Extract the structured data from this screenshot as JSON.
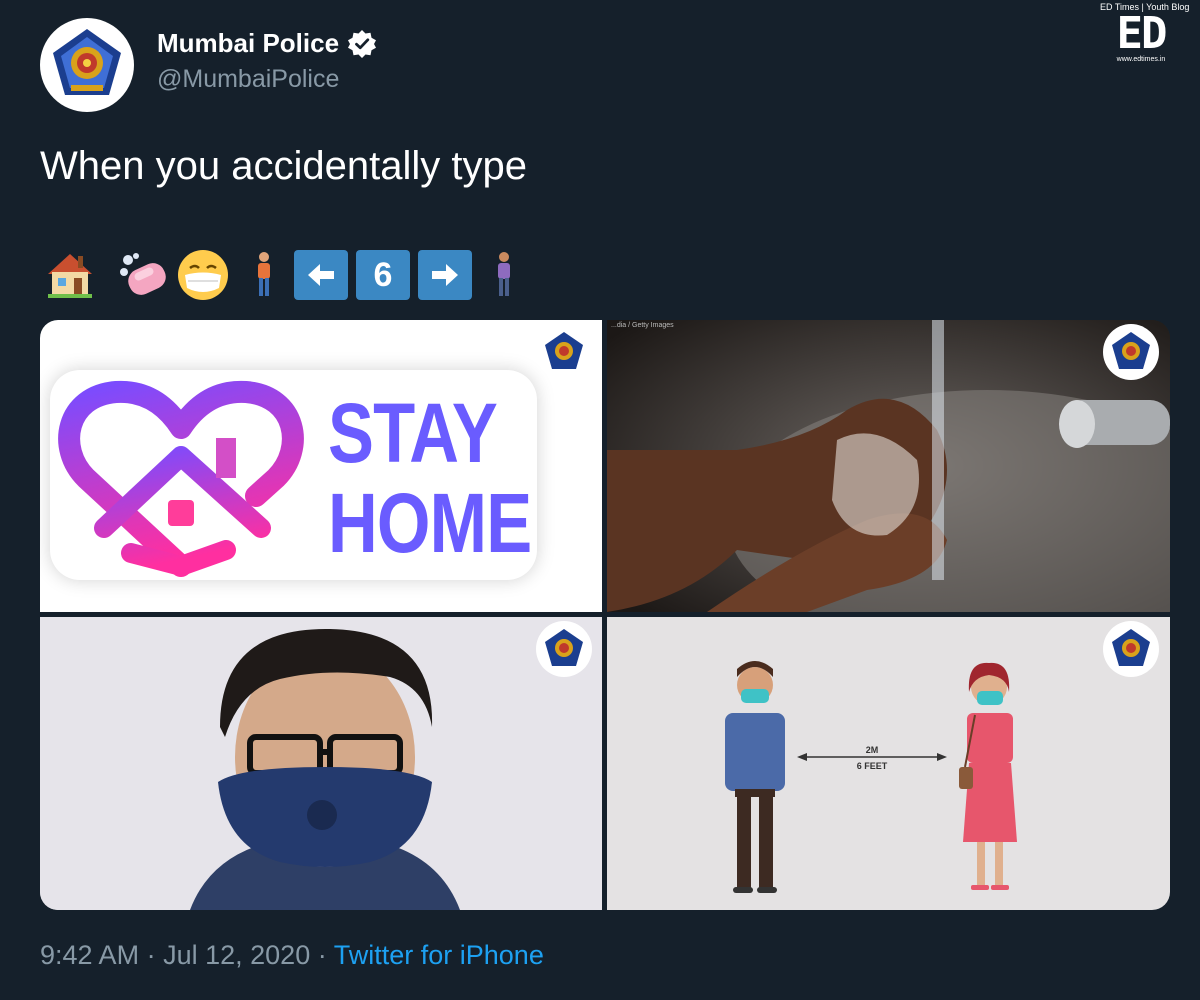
{
  "user": {
    "display_name": "Mumbai Police",
    "handle": "@MumbaiPolice",
    "verified": true
  },
  "watermark": {
    "top_text": "ED Times | Youth Blog",
    "logo_text": "ED",
    "url": "www.edtimes.in"
  },
  "tweet": {
    "text": "When you accidentally type",
    "emojis": [
      "house-icon",
      "soap-icon",
      "mask-face-icon",
      "person-icon",
      "left-arrow-key",
      "keycap-6",
      "right-arrow-key",
      "person-icon"
    ],
    "keycap_number": "6"
  },
  "images": {
    "stay_home": {
      "line1": "STAY",
      "line2": "HOME"
    },
    "handwash": {
      "credit": "...dia / Getty Images"
    },
    "distance": {
      "line1": "2M",
      "line2": "6 FEET"
    }
  },
  "footer": {
    "time": "9:42 AM",
    "separator": "·",
    "date": "Jul 12, 2020",
    "source": "Twitter for iPhone"
  },
  "colors": {
    "background": "#15202b",
    "link": "#1da1f2",
    "muted": "#8899a6",
    "keycap": "#3b88c3",
    "stay_home_text": "#6a5cff"
  }
}
